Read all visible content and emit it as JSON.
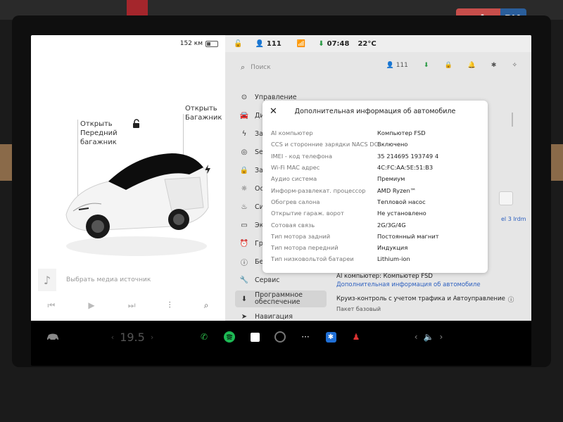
{
  "car_panel": {
    "range": "152 км",
    "open_frunk": [
      "Открыть",
      "Передний",
      "багажник"
    ],
    "open_trunk": [
      "Открыть",
      "Багажник"
    ],
    "media_label": "Выбрать медиа источник"
  },
  "status_bar": {
    "profile": "111",
    "time": "07:48",
    "temperature": "22°C"
  },
  "search": {
    "placeholder": "Поиск",
    "profile": "111"
  },
  "sidebar": {
    "items": [
      {
        "label": "Управление",
        "icon": "toggle-icon"
      },
      {
        "label": "Ди",
        "icon": "car-icon"
      },
      {
        "label": "Зар",
        "icon": "charge-icon"
      },
      {
        "label": "Self",
        "icon": "steering-icon"
      },
      {
        "label": "Зам",
        "icon": "lock-icon"
      },
      {
        "label": "Осв",
        "icon": "light-icon"
      },
      {
        "label": "Сид",
        "icon": "seat-icon"
      },
      {
        "label": "Экр",
        "icon": "display-icon"
      },
      {
        "label": "Гра",
        "icon": "schedule-icon"
      },
      {
        "label": "Без",
        "icon": "safety-icon"
      },
      {
        "label": "Сервис",
        "icon": "wrench-icon"
      },
      {
        "label": "Программное обеспечение",
        "icon": "download-icon"
      },
      {
        "label": "Навигация",
        "icon": "navigation-icon"
      }
    ]
  },
  "detail": {
    "ai_computer": "AI компьютер: Компьютер FSD",
    "more_info_link": "Дополнительная информация об автомобиле",
    "cruise": "Круиз-контроль с учетом трафика и Автоуправление",
    "package": "Пакет базовый",
    "right_link_fragment": "el 3 lrdm"
  },
  "modal": {
    "title": "Дополнительная информация об автомобиле",
    "rows": [
      {
        "k": "AI компьютер",
        "v": "Компьютер FSD"
      },
      {
        "k": "CCS и сторонние зарядки NACS DC",
        "v": "Включено"
      },
      {
        "k": "IMEI - код телефона",
        "v": "35 214695 193749 4"
      },
      {
        "k": "Wi-Fi MAC адрес",
        "v": "4C:FC:AA:5E:51:B3"
      },
      {
        "k": "Аудио система",
        "v": "Премиум"
      },
      {
        "k": "Информ-развлекат. процессор",
        "v": "AMD Ryzen™"
      },
      {
        "k": "Обогрев салона",
        "v": "Тепловой насос"
      },
      {
        "k": "Открытие гараж. ворот",
        "v": "Не установлено"
      },
      {
        "k": "Сотовая связь",
        "v": "2G/3G/4G"
      },
      {
        "k": "Тип мотора задний",
        "v": "Постоянный магнит"
      },
      {
        "k": "Тип мотора передний",
        "v": "Индукция"
      },
      {
        "k": "Тип низковольтой батареи",
        "v": "Lithium-ion"
      }
    ]
  },
  "dock": {
    "temperature": "19.5",
    "apps": [
      "phone-icon",
      "spotify-icon",
      "calendar-icon",
      "camera-icon",
      "more-icon",
      "bluetooth-icon",
      "joystick-icon"
    ]
  },
  "watermark": {
    "a": "auto",
    "b": "RIA"
  },
  "colors": {
    "accent_blue": "#2c5fbf",
    "green": "#2a9a45",
    "modal_bg": "#ffffff",
    "panel_bg": "#e6e6e6"
  }
}
